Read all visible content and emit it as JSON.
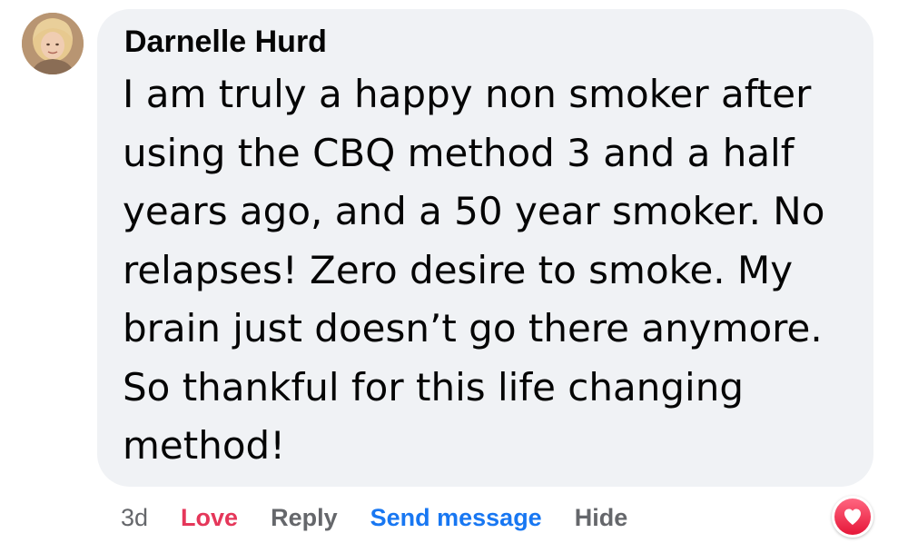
{
  "comment": {
    "author": "Darnelle Hurd",
    "lines": [
      "I am truly a happy non smoker after",
      "using the CBQ method 3 and a half",
      "years ago, and a 50 year smoker. No",
      "relapses! Zero desire to smoke. My",
      "brain just doesn’t go there anymore.",
      "So thankful for this life changing",
      "method!"
    ]
  },
  "actions": {
    "time": "3d",
    "love": "Love",
    "reply": "Reply",
    "send_message": "Send message",
    "hide": "Hide"
  },
  "reaction": {
    "icon": "heart-icon",
    "color": "#f33e58"
  },
  "colors": {
    "bubble": "#f0f2f5",
    "love": "#e5375a",
    "link": "#1877f2",
    "muted": "#65676b"
  }
}
